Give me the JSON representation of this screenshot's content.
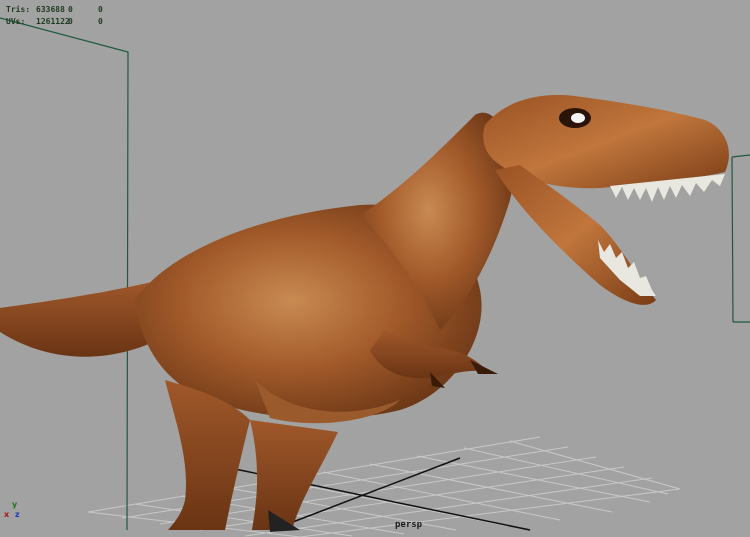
{
  "stats": {
    "rows": [
      {
        "label": "Tris:",
        "v1": "633688",
        "v2": "0",
        "v3": "0"
      },
      {
        "label": "UVs:",
        "v1": "1261122",
        "v2": "0",
        "v3": "0"
      }
    ]
  },
  "viewport": {
    "camera": "persp",
    "axis": {
      "x": "x",
      "y": "y",
      "z": "z"
    }
  },
  "colors": {
    "background": "#a2a2a2",
    "grid": "#c8c8c8",
    "grid_axis": "#101010",
    "guide_lines": "#1e5a3e",
    "model_base": "#8b4a20",
    "model_highlight": "#c98a52"
  }
}
